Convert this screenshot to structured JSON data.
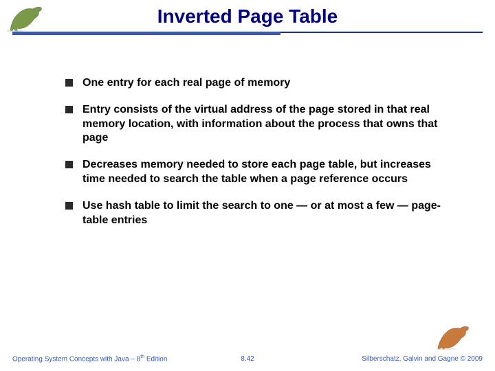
{
  "header": {
    "title": "Inverted Page Table"
  },
  "bullets": {
    "b0": "One entry for each real page of memory",
    "b1": "Entry consists of the virtual address of the page stored in that real memory location, with information about the process that owns that page",
    "b2": "Decreases memory needed to store each page table, but increases time needed to search the table when a page reference occurs",
    "b3": "Use hash table to limit the search to one — or at most a few — page-table entries"
  },
  "footer": {
    "left_a": "Operating System Concepts with Java – 8",
    "left_b": " Edition",
    "left_sup": "th",
    "center": "8.42",
    "right": "Silberschatz, Galvin and Gagne © 2009"
  },
  "icons": {
    "dino_top": "dinosaur-icon",
    "dino_bottom": "dinosaur-icon"
  }
}
